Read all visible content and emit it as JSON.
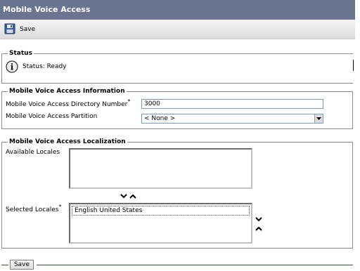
{
  "window": {
    "title": "Mobile Voice Access"
  },
  "toolbar": {
    "save_label": "Save",
    "save_icon": "floppy-disk-icon"
  },
  "status": {
    "legend": "Status",
    "text": "Status: Ready",
    "icon": "info-icon"
  },
  "info": {
    "legend": "Mobile Voice Access Information",
    "directory_number_label": "Mobile Voice Access Directory Number",
    "directory_number_value": "3000",
    "partition_label": "Mobile Voice Access Partition",
    "partition_value": "< None >",
    "required_marker": "*"
  },
  "localization": {
    "legend": "Mobile Voice Access Localization",
    "available_label": "Available Locales",
    "available_items": [],
    "selected_label": "Selected Locales",
    "selected_items": [
      "English United States"
    ],
    "required_marker": "*"
  },
  "footer": {
    "save_label": "Save"
  },
  "colors": {
    "titlebar": "#6b7590",
    "rule": "#2f5d2f"
  }
}
